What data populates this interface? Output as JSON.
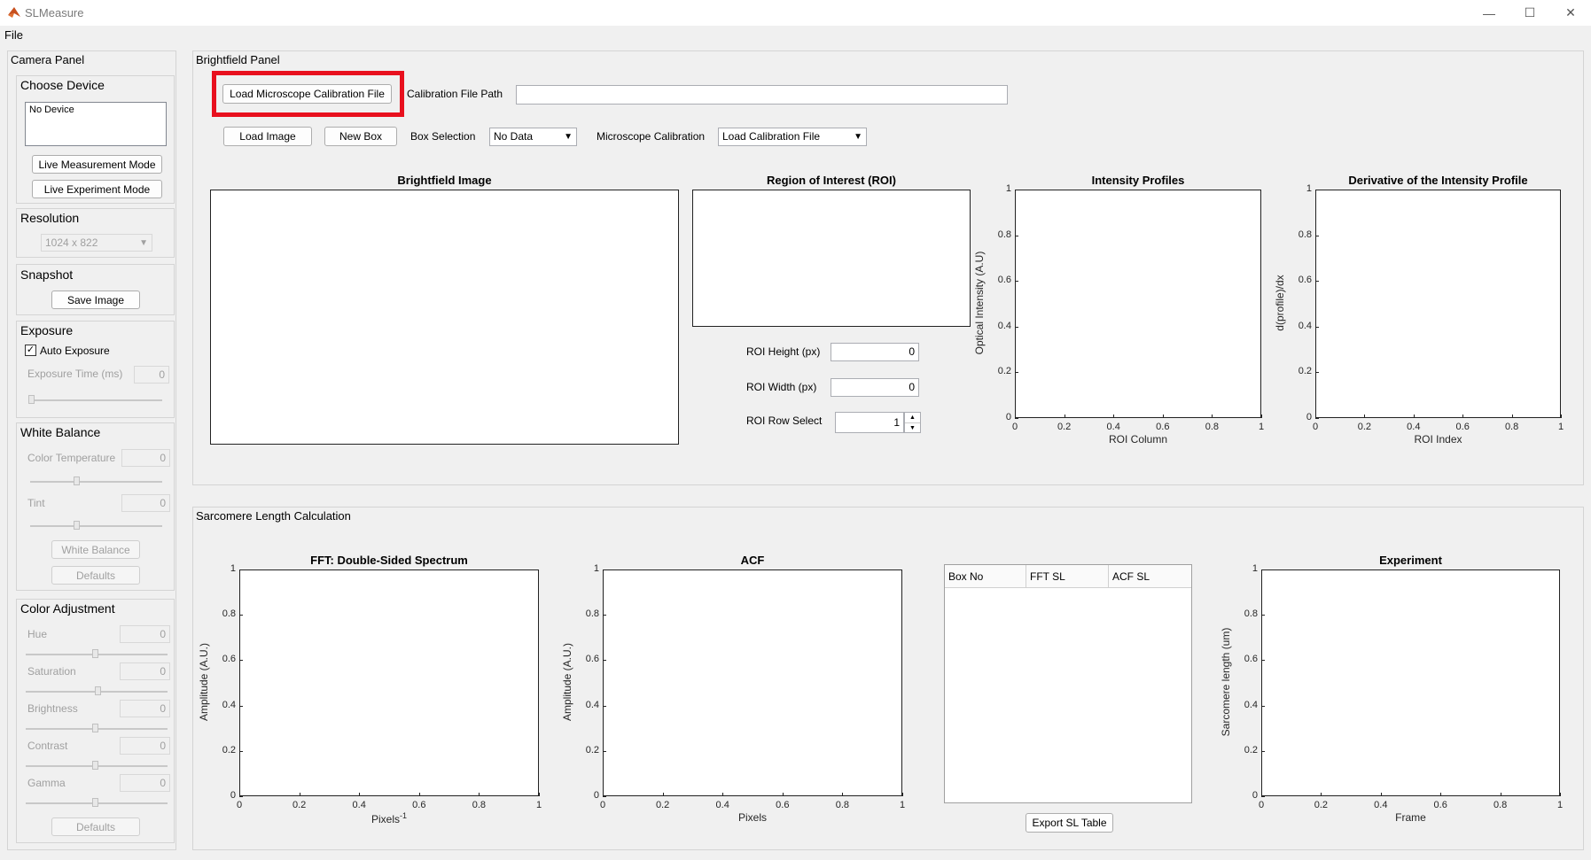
{
  "window": {
    "title": "SLMeasure",
    "minimize": "—",
    "maximize": "☐",
    "close": "✕"
  },
  "menu": {
    "file": "File"
  },
  "camera_panel": {
    "title": "Camera Panel",
    "choose_device": {
      "title": "Choose Device",
      "device_list": "No Device",
      "live_measurement": "Live Measurement Mode",
      "live_experiment": "Live Experiment Mode"
    },
    "resolution": {
      "title": "Resolution",
      "value": "1024 x 822"
    },
    "snapshot": {
      "title": "Snapshot",
      "save": "Save Image"
    },
    "exposure": {
      "title": "Exposure",
      "auto_label": "Auto Exposure",
      "auto_checked": true,
      "time_label": "Exposure Time (ms)",
      "time_value": "0"
    },
    "white_balance": {
      "title": "White Balance",
      "color_temp_label": "Color Temperature",
      "color_temp_value": "0",
      "tint_label": "Tint",
      "tint_value": "0",
      "wb_button": "White Balance",
      "defaults_button": "Defaults"
    },
    "color_adjustment": {
      "title": "Color Adjustment",
      "hue_label": "Hue",
      "hue_value": "0",
      "saturation_label": "Saturation",
      "saturation_value": "0",
      "brightness_label": "Brightness",
      "brightness_value": "0",
      "contrast_label": "Contrast",
      "contrast_value": "0",
      "gamma_label": "Gamma",
      "gamma_value": "0",
      "defaults_button": "Defaults"
    }
  },
  "brightfield_panel": {
    "title": "Brightfield Panel",
    "load_calibration": "Load Microscope Calibration File",
    "calibration_path_label": "Calibration File Path",
    "calibration_path_value": "",
    "load_image": "Load Image",
    "new_box": "New Box",
    "box_selection_label": "Box Selection",
    "box_selection_value": "No Data",
    "microscope_calibration_label": "Microscope Calibration",
    "microscope_calibration_value": "Load Calibration File",
    "brightfield_image_title": "Brightfield Image",
    "roi_title": "Region of Interest (ROI)",
    "roi_height_label": "ROI Height (px)",
    "roi_height_value": "0",
    "roi_width_label": "ROI Width (px)",
    "roi_width_value": "0",
    "roi_row_label": "ROI Row Select",
    "roi_row_value": "1"
  },
  "sarcomere_panel": {
    "title": "Sarcomere Length Calculation",
    "table_headers": [
      "Box No",
      "FFT SL",
      "ACF SL"
    ],
    "export_button": "Export SL Table"
  },
  "chart_data": [
    {
      "type": "line",
      "title": "Intensity Profiles",
      "xlabel": "ROI Column",
      "ylabel": "Optical Intensity (A.U)",
      "xlim": [
        0,
        1
      ],
      "ylim": [
        0,
        1
      ],
      "xticks": [
        "0",
        "0.2",
        "0.4",
        "0.6",
        "0.8",
        "1"
      ],
      "yticks": [
        "0",
        "0.2",
        "0.4",
        "0.6",
        "0.8",
        "1"
      ],
      "series": []
    },
    {
      "type": "line",
      "title": "Derivative of the Intensity Profile",
      "xlabel": "ROI Index",
      "ylabel": "d(profile)/dx",
      "xlim": [
        0,
        1
      ],
      "ylim": [
        0,
        1
      ],
      "xticks": [
        "0",
        "0.2",
        "0.4",
        "0.6",
        "0.8",
        "1"
      ],
      "yticks": [
        "0",
        "0.2",
        "0.4",
        "0.6",
        "0.8",
        "1"
      ],
      "series": []
    },
    {
      "type": "line",
      "title": "FFT: Double-Sided Spectrum",
      "xlabel": "Pixels",
      "xlabel_sup": "-1",
      "ylabel": "Amplitude (A.U.)",
      "xlim": [
        0,
        1
      ],
      "ylim": [
        0,
        1
      ],
      "xticks": [
        "0",
        "0.2",
        "0.4",
        "0.6",
        "0.8",
        "1"
      ],
      "yticks": [
        "0",
        "0.2",
        "0.4",
        "0.6",
        "0.8",
        "1"
      ],
      "series": []
    },
    {
      "type": "line",
      "title": "ACF",
      "xlabel": "Pixels",
      "ylabel": "Amplitude (A.U.)",
      "xlim": [
        0,
        1
      ],
      "ylim": [
        0,
        1
      ],
      "xticks": [
        "0",
        "0.2",
        "0.4",
        "0.6",
        "0.8",
        "1"
      ],
      "yticks": [
        "0",
        "0.2",
        "0.4",
        "0.6",
        "0.8",
        "1"
      ],
      "series": []
    },
    {
      "type": "line",
      "title": "Experiment",
      "xlabel": "Frame",
      "ylabel": "Sarcomere length (um)",
      "xlim": [
        0,
        1
      ],
      "ylim": [
        0,
        1
      ],
      "xticks": [
        "0",
        "0.2",
        "0.4",
        "0.6",
        "0.8",
        "1"
      ],
      "yticks": [
        "0",
        "0.2",
        "0.4",
        "0.6",
        "0.8",
        "1"
      ],
      "series": []
    }
  ],
  "colors": {
    "highlight": "#e8101e",
    "background": "#f0f0f0"
  },
  "icons": {
    "app": "matlab-icon",
    "checkbox": "checkmark-icon",
    "dropdown": "triangle-down-icon"
  }
}
